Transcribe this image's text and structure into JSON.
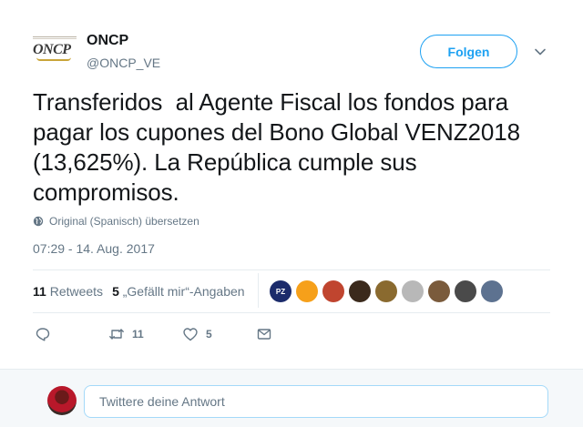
{
  "tweet": {
    "author_logo_text": "ONCP",
    "author_name": "ONCP",
    "author_handle": "@ONCP_VE",
    "follow_label": "Folgen",
    "text": "Transferidos  al Agente Fiscal los fondos para pagar los cupones del Bono Global VENZ2018 (13,625%). La República cumple sus compromisos.",
    "translate_label": "Original (Spanisch) übersetzen",
    "timestamp": "07:29 - 14. Aug. 2017",
    "retweets_count": "11",
    "retweets_label": "Retweets",
    "likes_count": "5",
    "likes_label": "„Gefällt mir“-Angaben",
    "likers": [
      {
        "name": "liker-1",
        "color": "#1b2b6b",
        "label": "PZ"
      },
      {
        "name": "liker-2",
        "color": "#f6a01a",
        "label": ""
      },
      {
        "name": "liker-3",
        "color": "#c0452f",
        "label": ""
      },
      {
        "name": "liker-4",
        "color": "#3b2a1c",
        "label": ""
      },
      {
        "name": "liker-5",
        "color": "#8a6a2f",
        "label": ""
      },
      {
        "name": "liker-6",
        "color": "#b8b8b8",
        "label": ""
      },
      {
        "name": "liker-7",
        "color": "#7a5b3c",
        "label": ""
      },
      {
        "name": "liker-8",
        "color": "#4a4a4a",
        "label": ""
      },
      {
        "name": "liker-9",
        "color": "#5d7290",
        "label": ""
      }
    ],
    "actions": {
      "reply_icon": "reply-icon",
      "retweet_icon": "retweet-icon",
      "retweet_count": "11",
      "like_icon": "heart-icon",
      "like_count": "5",
      "dm_icon": "envelope-icon"
    }
  },
  "reply": {
    "placeholder": "Twittere deine Antwort"
  },
  "colors": {
    "accent": "#1da1f2",
    "secondary_text": "#657786",
    "divider": "#e6ecf0"
  }
}
